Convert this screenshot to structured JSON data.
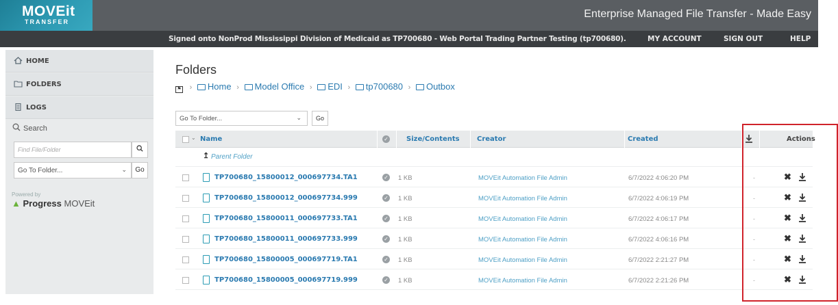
{
  "header": {
    "logo_main": "MOVEit",
    "logo_sub": "TRANSFER",
    "tagline": "Enterprise Managed File Transfer - Made Easy"
  },
  "statusbar": {
    "signed_on": "Signed onto NonProd Mississippi Division of Medicaid as TP700680 - Web Portal Trading Partner Testing (tp700680).",
    "my_account": "MY ACCOUNT",
    "sign_out": "SIGN OUT",
    "help": "HELP"
  },
  "sidebar": {
    "items": [
      {
        "label": "HOME",
        "icon": "home-icon"
      },
      {
        "label": "FOLDERS",
        "icon": "folder-icon"
      },
      {
        "label": "LOGS",
        "icon": "logs-icon"
      }
    ],
    "search_label": "Search",
    "search_placeholder": "Find File/Folder",
    "goto_value": "Go To Folder...",
    "go_label": "Go",
    "powered_by": "Powered by",
    "brand_progress": "Progress",
    "brand_moveit": "MOVEit"
  },
  "main": {
    "title": "Folders",
    "breadcrumb": [
      "Home",
      "Model Office",
      "EDI",
      "tp700680",
      "Outbox"
    ],
    "goto_value": "Go To Folder...",
    "go_label": "Go",
    "columns": {
      "name": "Name",
      "size": "Size/Contents",
      "creator": "Creator",
      "created": "Created",
      "actions": "Actions"
    },
    "parent_folder": "Parent Folder",
    "rows": [
      {
        "name": "TP700680_15800012_000697734.TA1",
        "size": "1 KB",
        "creator": "MOVEit Automation File Admin",
        "created": "6/7/2022 4:06:20 PM",
        "downloads": "-"
      },
      {
        "name": "TP700680_15800012_000697734.999",
        "size": "1 KB",
        "creator": "MOVEit Automation File Admin",
        "created": "6/7/2022 4:06:19 PM",
        "downloads": "-"
      },
      {
        "name": "TP700680_15800011_000697733.TA1",
        "size": "1 KB",
        "creator": "MOVEit Automation File Admin",
        "created": "6/7/2022 4:06:17 PM",
        "downloads": "-"
      },
      {
        "name": "TP700680_15800011_000697733.999",
        "size": "1 KB",
        "creator": "MOVEit Automation File Admin",
        "created": "6/7/2022 4:06:16 PM",
        "downloads": "-"
      },
      {
        "name": "TP700680_15800005_000697719.TA1",
        "size": "1 KB",
        "creator": "MOVEit Automation File Admin",
        "created": "6/7/2022 2:21:27 PM",
        "downloads": "-"
      },
      {
        "name": "TP700680_15800005_000697719.999",
        "size": "1 KB",
        "creator": "MOVEit Automation File Admin",
        "created": "6/7/2022 2:21:26 PM",
        "downloads": "-"
      }
    ]
  },
  "colors": {
    "header_bg": "#5a5e62",
    "status_bg": "#3a3d40",
    "logo_teal": "#2e9bb4",
    "link_blue": "#2a7ab0",
    "highlight_red": "#d0222a"
  }
}
